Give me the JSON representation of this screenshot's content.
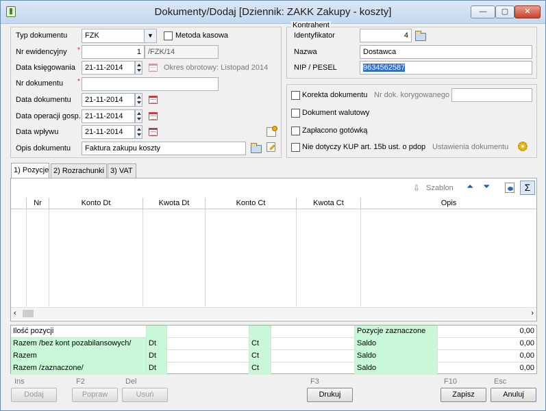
{
  "window": {
    "title": "Dokumenty/Dodaj [Dziennik: ZAKK  Zakupy - koszty]",
    "min": "—",
    "max": "▢",
    "close": "✕"
  },
  "doc": {
    "typ_label": "Typ dokumentu",
    "typ_value": "FZK",
    "metoda_label": "Metoda kasowa",
    "nr_ew_label": "Nr ewidencyjny",
    "nr_ew_value": "1",
    "nr_ew_suffix": "/FZK/14",
    "data_ksieg_label": "Data księgowania",
    "data_ksieg_value": "21-11-2014",
    "okres": "Okres obrotowy: Listopad 2014",
    "nr_dok_label": "Nr dokumentu",
    "nr_dok_value": "",
    "data_dok_label": "Data dokumentu",
    "data_dok_value": "21-11-2014",
    "data_op_label": "Data operacji gosp.",
    "data_op_value": "21-11-2014",
    "data_wpl_label": "Data wpływu",
    "data_wpl_value": "21-11-2014",
    "opis_label": "Opis dokumentu",
    "opis_value": "Faktura zakupu koszty"
  },
  "kontrahent": {
    "group": "Kontrahent",
    "id_label": "Identyfikator",
    "id_value": "4",
    "nazwa_label": "Nazwa",
    "nazwa_value": "Dostawca",
    "nip_label": "NIP / PESEL",
    "nip_value": "9634562587"
  },
  "options": {
    "korekta": "Korekta dokumentu",
    "nr_kor_label": "Nr dok. korygowanego",
    "nr_kor_value": "",
    "walutowy": "Dokument walutowy",
    "gotowka": "Zapłacono gotówką",
    "kup": "Nie dotyczy KUP art. 15b ust. o pdop",
    "ustawienia": "Ustawienia dokumentu"
  },
  "tabs": [
    {
      "label": "1) Pozycje"
    },
    {
      "label": "2) Rozrachunki"
    },
    {
      "label": "3) VAT"
    }
  ],
  "toolbar": {
    "szablon": "Szablon"
  },
  "grid": {
    "columns": [
      "Nr",
      "Konto Dt",
      "Kwota Dt",
      "Konto Ct",
      "Kwota Ct",
      "Opis"
    ]
  },
  "summary": {
    "ilosc": "Ilość pozycji",
    "razem_bez": "Razem /bez kont pozabilansowych/",
    "razem": "Razem",
    "razem_zazn": "Razem /zaznaczone/",
    "dt": "Dt",
    "ct": "Ct",
    "poz_zazn": "Pozycje zaznaczone",
    "saldo": "Saldo",
    "values": [
      "0,00",
      "0,00",
      "0,00",
      "0,00"
    ]
  },
  "buttons": {
    "ins_key": "Ins",
    "dodaj": "Dodaj",
    "f2_key": "F2",
    "popraw": "Popraw",
    "del_key": "Del",
    "usun": "Usuń",
    "f3_key": "F3",
    "drukuj": "Drukuj",
    "f10_key": "F10",
    "zapisz": "Zapisz",
    "esc_key": "Esc",
    "anuluj": "Anuluj"
  },
  "icons": [
    "app-icon",
    "calendar-icon",
    "folder-icon",
    "edit-icon",
    "settings-gear-icon",
    "arrow-down-icon",
    "move-up-icon",
    "move-down-icon",
    "view-icon",
    "sum-icon"
  ]
}
